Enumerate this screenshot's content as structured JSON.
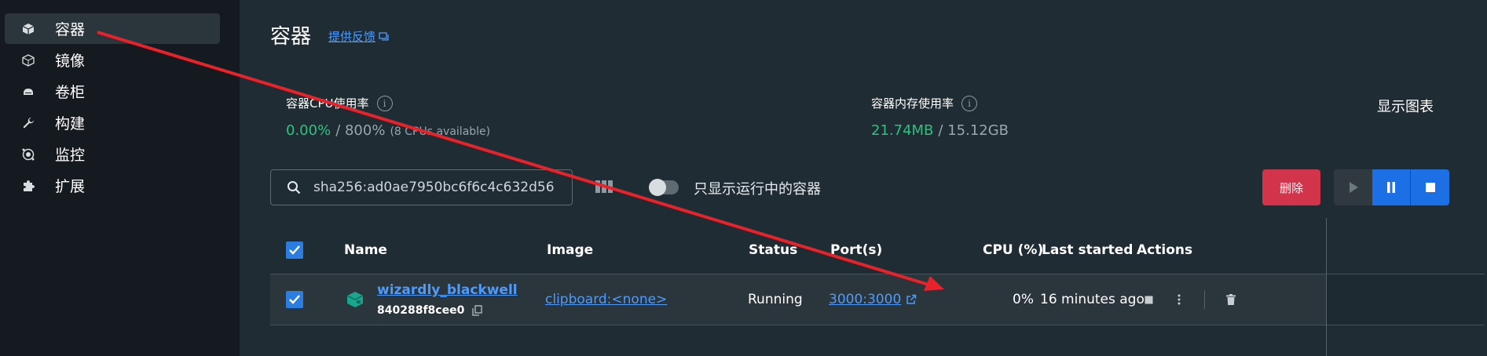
{
  "sidebar": {
    "items": [
      {
        "label": "容器",
        "icon": "cube-icon",
        "active": true
      },
      {
        "label": "镜像",
        "icon": "layers-icon"
      },
      {
        "label": "卷柜",
        "icon": "disk-icon"
      },
      {
        "label": "构建",
        "icon": "wrench-icon"
      },
      {
        "label": "监控",
        "icon": "monitor-icon"
      },
      {
        "label": "扩展",
        "icon": "puzzle-icon"
      }
    ]
  },
  "header": {
    "title": "容器",
    "feedback_label": "提供反馈"
  },
  "stats": {
    "cpu": {
      "label": "容器CPU使用率",
      "value": "0.00%",
      "total": "/ 800%",
      "note": "(8 CPUs available)"
    },
    "memory": {
      "label": "容器内存使用率",
      "value": "21.74MB",
      "total": "/ 15.12GB"
    },
    "show_charts_label": "显示图表"
  },
  "toolbar": {
    "search_value": "sha256:ad0ae7950bc6f6c4c632d56",
    "only_running_label": "只显示运行中的容器",
    "only_running_on": false,
    "delete_label": "删除"
  },
  "table": {
    "headers": {
      "name": "Name",
      "image": "Image",
      "status": "Status",
      "ports": "Port(s)",
      "cpu": "CPU (%)",
      "last_started": "Last started",
      "actions": "Actions"
    },
    "rows": [
      {
        "name": "wizardly_blackwell",
        "id": "840288f8cee0",
        "image": "clipboard:<none>",
        "status": "Running",
        "ports": "3000:3000",
        "cpu": "0%",
        "last_started": "16 minutes ago",
        "selected": true
      }
    ]
  },
  "colors": {
    "accent": "#2b7de0",
    "link": "#4d9bff",
    "danger": "#d1344b",
    "green": "#2ec27e",
    "annotation_arrow": "#e8222b",
    "container_icon": "#1aa68c"
  }
}
